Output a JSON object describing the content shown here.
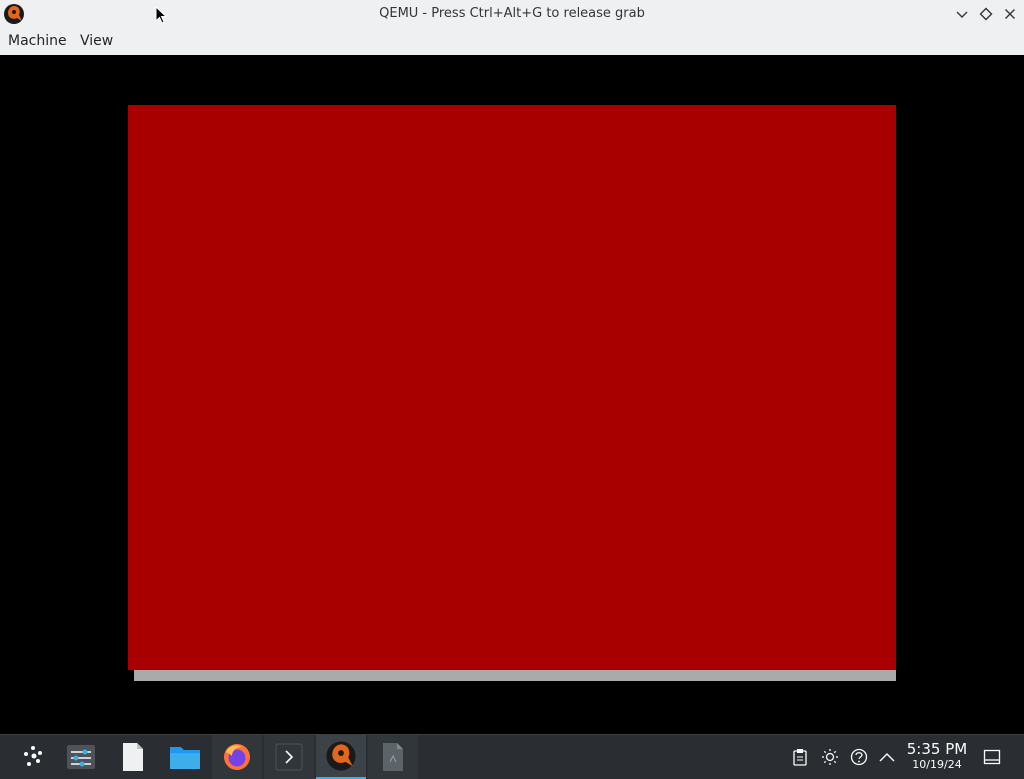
{
  "window": {
    "title": "QEMU - Press Ctrl+Alt+G to release grab",
    "icon": "qemu-icon",
    "controls": [
      "minimize-icon",
      "maximize-icon",
      "close-icon"
    ]
  },
  "menubar": {
    "items": [
      {
        "label": "Machine"
      },
      {
        "label": "View"
      }
    ]
  },
  "vm": {
    "screen_color": "#a80000",
    "bar_color": "#aaaaaa"
  },
  "taskbar": {
    "launcher": "application-launcher-icon",
    "tasks": [
      {
        "name": "system-settings-icon"
      },
      {
        "name": "text-file-icon"
      },
      {
        "name": "folder-icon"
      },
      {
        "name": "firefox-icon"
      },
      {
        "name": "terminal-icon"
      },
      {
        "name": "qemu-icon"
      },
      {
        "name": "document-icon"
      }
    ],
    "tray": [
      "clipboard-icon",
      "brightness-icon",
      "network-icon",
      "show-hidden-icon"
    ],
    "clock": {
      "time": "5:35 PM",
      "date": "10/19/24"
    },
    "show_desktop": "show-desktop-icon"
  },
  "colors": {
    "titlebar_bg": "#eff0f1",
    "taskbar_bg": "#2a2e32",
    "accent": "#3daee9"
  }
}
